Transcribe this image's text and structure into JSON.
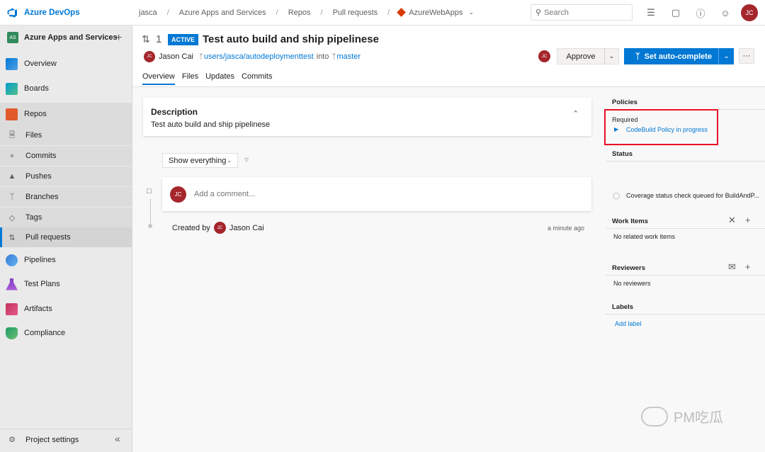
{
  "app": {
    "brand": "Azure DevOps"
  },
  "breadcrumb": {
    "items": [
      "jasca",
      "Azure Apps and Services",
      "Repos",
      "Pull requests"
    ],
    "repo": "AzureWebApps"
  },
  "search": {
    "placeholder": "Search"
  },
  "user": {
    "initials": "JC"
  },
  "sidebar": {
    "project_badge": "AS",
    "project_name": "Azure Apps and Services",
    "items": [
      {
        "label": "Overview"
      },
      {
        "label": "Boards"
      },
      {
        "label": "Repos"
      },
      {
        "label": "Files"
      },
      {
        "label": "Commits"
      },
      {
        "label": "Pushes"
      },
      {
        "label": "Branches"
      },
      {
        "label": "Tags"
      },
      {
        "label": "Pull requests"
      },
      {
        "label": "Pipelines"
      },
      {
        "label": "Test Plans"
      },
      {
        "label": "Artifacts"
      },
      {
        "label": "Compliance"
      }
    ],
    "settings": "Project settings"
  },
  "pr": {
    "id": "1",
    "status": "ACTIVE",
    "title": "Test auto build and ship pipelinese",
    "author": "Jason Cai",
    "source_branch": "users/jasca/autodeploymenttest",
    "into": "into",
    "target_branch": "master",
    "tabs": [
      "Overview",
      "Files",
      "Updates",
      "Commits"
    ]
  },
  "actions": {
    "approve": "Approve",
    "autocomplete": "Set auto-complete",
    "more": "···"
  },
  "description": {
    "title": "Description",
    "text": "Test auto build and ship pipelinese"
  },
  "activity": {
    "filter": "Show everything",
    "comment_placeholder": "Add a comment...",
    "created_by": "Created by",
    "created_author": "Jason Cai",
    "created_time": "a minute ago"
  },
  "right_panel": {
    "policies_title": "Policies",
    "required_label": "Required",
    "policy": "CodeBuild Policy in progress",
    "status_title": "Status",
    "status_item": "Coverage status check queued for BuildAndP...",
    "work_items_title": "Work Items",
    "work_items_empty": "No related work items",
    "reviewers_title": "Reviewers",
    "reviewers_empty": "No reviewers",
    "labels_title": "Labels",
    "add_label": "Add label"
  },
  "watermark": "PM吃瓜",
  "colors": {
    "accent": "#0078d4",
    "avatar": "#a4262c",
    "highlight": "#e81123"
  }
}
